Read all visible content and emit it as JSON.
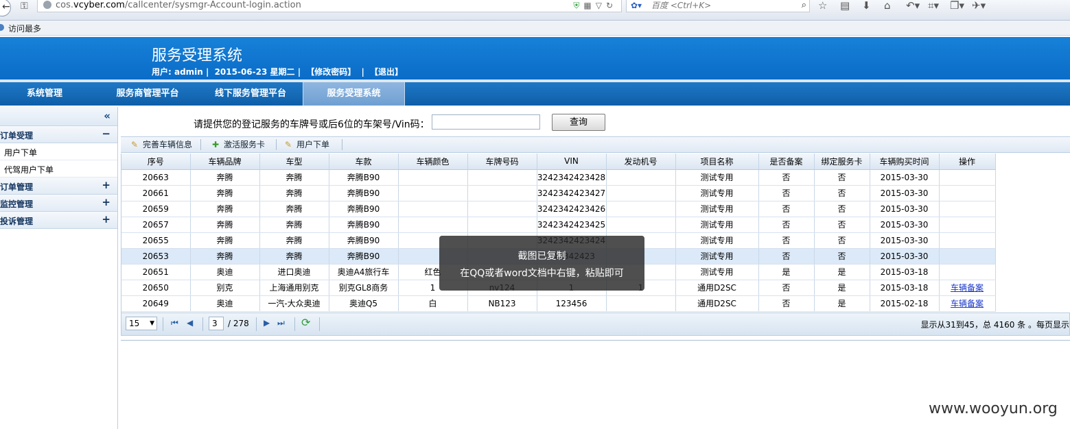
{
  "browser": {
    "url_prefix": "cos.",
    "url_domain": "vcyber.com",
    "url_path": "/callcenter/sysmgr-Account-login.action",
    "search_placeholder": "百度 <Ctrl+K>",
    "bookmark": "访问最多"
  },
  "header": {
    "title": "服务受理系统",
    "user": "用户: admin |",
    "date": "2015-06-23 星期二 |",
    "change_password": "【修改密码】",
    "sep": "|",
    "logout": "【退出】"
  },
  "topnav": [
    {
      "label": "系统管理"
    },
    {
      "label": "服务商管理平台"
    },
    {
      "label": "线下服务管理平台"
    },
    {
      "label": "服务受理系统"
    }
  ],
  "sidebar": {
    "collapse": "«",
    "groups": [
      {
        "label": "订单受理",
        "sign": "−",
        "items": [
          "用户下单",
          "代驾用户下单"
        ]
      },
      {
        "label": "订单管理",
        "sign": "+"
      },
      {
        "label": "监控管理",
        "sign": "+"
      },
      {
        "label": "投诉管理",
        "sign": "+"
      }
    ]
  },
  "query": {
    "label": "请提供您的登记服务的车牌号或后6位的车架号/Vin码：",
    "value": "",
    "button": "查询"
  },
  "toolbar": {
    "btn1": "完善车辆信息",
    "btn2": "激活服务卡",
    "btn3": "用户下单"
  },
  "table": {
    "headers": [
      "序号",
      "车辆品牌",
      "车型",
      "车款",
      "车辆颜色",
      "车牌号码",
      "VIN",
      "发动机号",
      "项目名称",
      "是否备案",
      "绑定服务卡",
      "车辆购买时间",
      "操作"
    ],
    "rows": [
      [
        "20663",
        "奔腾",
        "奔腾",
        "奔腾B90",
        "",
        "",
        "3242342423428",
        "",
        "测试专用",
        "否",
        "否",
        "2015-03-30",
        ""
      ],
      [
        "20661",
        "奔腾",
        "奔腾",
        "奔腾B90",
        "",
        "",
        "3242342423427",
        "",
        "测试专用",
        "否",
        "否",
        "2015-03-30",
        ""
      ],
      [
        "20659",
        "奔腾",
        "奔腾",
        "奔腾B90",
        "",
        "",
        "3242342423426",
        "",
        "测试专用",
        "否",
        "否",
        "2015-03-30",
        ""
      ],
      [
        "20657",
        "奔腾",
        "奔腾",
        "奔腾B90",
        "",
        "",
        "3242342423425",
        "",
        "测试专用",
        "否",
        "否",
        "2015-03-30",
        ""
      ],
      [
        "20655",
        "奔腾",
        "奔腾",
        "奔腾B90",
        "",
        "",
        "3242342423424",
        "",
        "测试专用",
        "否",
        "否",
        "2015-03-30",
        ""
      ],
      [
        "20653",
        "奔腾",
        "奔腾",
        "奔腾B90",
        "",
        "",
        "342342423",
        "",
        "测试专用",
        "否",
        "否",
        "2015-03-30",
        ""
      ],
      [
        "20651",
        "奥迪",
        "进口奥迪",
        "奥迪A4旅行车",
        "红色",
        "",
        "",
        "",
        "测试专用",
        "是",
        "是",
        "2015-03-18",
        ""
      ],
      [
        "20650",
        "别克",
        "上海通用别克",
        "别克GL8商务",
        "1",
        "nv124",
        "1",
        "1",
        "通用D2SC",
        "否",
        "是",
        "2015-03-18",
        "车辆备案"
      ],
      [
        "20649",
        "奥迪",
        "一汽-大众奥迪",
        "奥迪Q5",
        "白",
        "NB123",
        "123456",
        "",
        "通用D2SC",
        "否",
        "是",
        "2015-02-18",
        "车辆备案"
      ]
    ],
    "selected_row": 5
  },
  "pager": {
    "page_size": "15",
    "current_page": "3",
    "total_pages": "/ 278",
    "info": "显示从31到45，总 4160 条 。每页显示"
  },
  "toast": {
    "line1": "截图已复制",
    "line2": "在QQ或者word文档中右键，粘贴即可"
  },
  "watermark": "www.wooyun.org"
}
